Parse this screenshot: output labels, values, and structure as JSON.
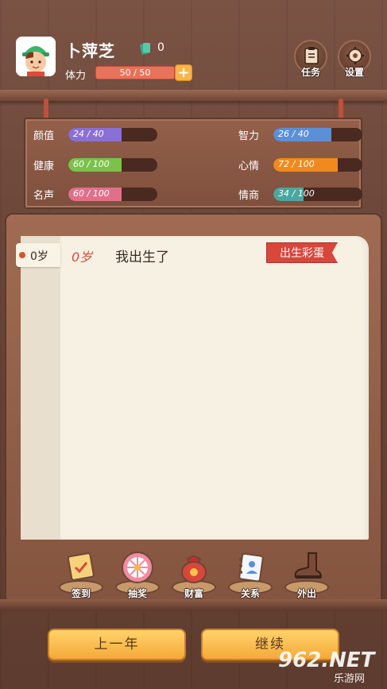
{
  "player": {
    "name": "卜萍芝",
    "money": "0",
    "stamina_label": "体力",
    "stamina_value": "50 / 50",
    "stamina_plus": "+"
  },
  "top_buttons": {
    "tasks": "任务",
    "settings": "设置"
  },
  "stats": [
    {
      "name": "颜值",
      "value": "24 / 40",
      "fraction": 0.6,
      "color": "#8a6fd6"
    },
    {
      "name": "健康",
      "value": "60 / 100",
      "fraction": 0.6,
      "color": "#7cc24a"
    },
    {
      "name": "名声",
      "value": "60 / 100",
      "fraction": 0.6,
      "color": "#e0708a"
    },
    {
      "name": "智力",
      "value": "26 / 40",
      "fraction": 0.65,
      "color": "#5b8fd8"
    },
    {
      "name": "心情",
      "value": "72 / 100",
      "fraction": 0.72,
      "color": "#f08a1e"
    },
    {
      "name": "情商",
      "value": "34 / 100",
      "fraction": 0.34,
      "color": "#4aa6a0"
    }
  ],
  "log": {
    "age_tab": "0岁",
    "entry_age": "0岁",
    "entry_text": "我出生了",
    "easter_egg": "出生彩蛋"
  },
  "actions": [
    {
      "label": "签到",
      "icon": "calendar-icon"
    },
    {
      "label": "抽奖",
      "icon": "wheel-icon"
    },
    {
      "label": "财富",
      "icon": "money-bag-icon"
    },
    {
      "label": "关系",
      "icon": "contacts-book-icon"
    },
    {
      "label": "外出",
      "icon": "boot-icon"
    }
  ],
  "buttons": {
    "prev_year": "上一年",
    "continue": "继续"
  },
  "watermark": {
    "main": "962.NET",
    "sub": "乐游网"
  }
}
